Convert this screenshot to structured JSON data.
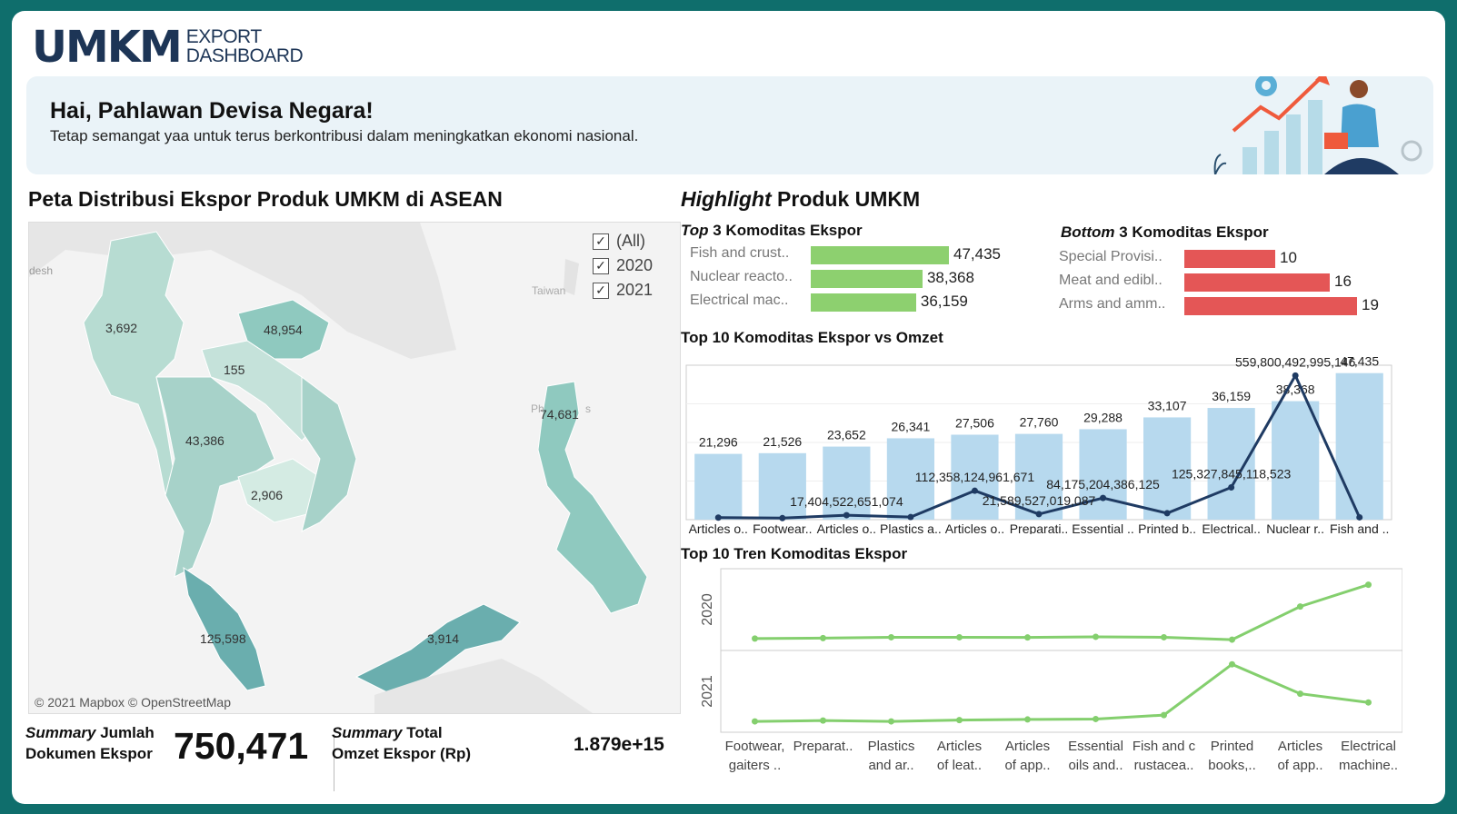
{
  "header": {
    "logo_main": "UMKM",
    "logo_sub_1": "EXPORT",
    "logo_sub_2": "DASHBOARD"
  },
  "banner": {
    "title": "Hai, Pahlawan Devisa Negara!",
    "subtitle": "Tetap semangat yaa untuk terus berkontribusi dalam meningkatkan ekonomi nasional."
  },
  "map": {
    "title": "Peta Distribusi Ekspor Produk UMKM di ASEAN",
    "values": [
      "3,692",
      "48,954",
      "155",
      "43,386",
      "2,906",
      "74,681",
      "125,598",
      "3,914"
    ],
    "place_labels": [
      "desh",
      "Taiwan",
      "Ph",
      "s"
    ],
    "copyright": "© 2021 Mapbox © OpenStreetMap",
    "filter": [
      {
        "label": "(All)",
        "checked": true
      },
      {
        "label": "2020",
        "checked": true
      },
      {
        "label": "2021",
        "checked": true
      }
    ]
  },
  "summary": {
    "docs_label_1_em": "Summary",
    "docs_label_1_rest": " Jumlah",
    "docs_label_2": "Dokumen Ekspor",
    "docs_value": "750,471",
    "omzet_label_1_em": "Summary",
    "omzet_label_1_rest": " Total",
    "omzet_label_2": "Omzet Ekspor (Rp)",
    "omzet_value": "1.879e+15"
  },
  "highlight": {
    "title_em": "Highlight",
    "title_rest": " Produk UMKM",
    "top3_title_em": "Top",
    "top3_title_rest": " 3 Komoditas Ekspor",
    "bottom3_title_em": "Bottom",
    "bottom3_title_rest": " 3 Komoditas Ekspor",
    "top10_title": "Top 10 Komoditas Ekspor vs Omzet",
    "trend_title": "Top 10 Tren Komoditas Ekspor"
  },
  "colors": {
    "green_bar": "#8dd06f",
    "red_bar": "#e45656",
    "blue_bar": "#b7d9ee",
    "navy_line": "#1f3b63",
    "trend_line": "#84cf6e",
    "map_fill": "#a7d2c9",
    "banner_bg": "#eaf3f8"
  },
  "chart_data": [
    {
      "type": "bar",
      "orientation": "horizontal",
      "title": "Top 3 Komoditas Ekspor",
      "categories": [
        "Fish and crust..",
        "Nuclear reacto..",
        "Electrical mac.."
      ],
      "values": [
        47435,
        38368,
        36159
      ],
      "value_labels": [
        "47,435",
        "38,368",
        "36,159"
      ]
    },
    {
      "type": "bar",
      "orientation": "horizontal",
      "title": "Bottom 3 Komoditas Ekspor",
      "categories": [
        "Special Provisi..",
        "Meat and edibl..",
        "Arms and amm.."
      ],
      "values": [
        10,
        16,
        19
      ],
      "value_labels": [
        "10",
        "16",
        "19"
      ]
    },
    {
      "type": "bar",
      "title": "Top 10 Komoditas Ekspor vs Omzet",
      "categories": [
        "Articles o..",
        "Footwear..",
        "Articles o..",
        "Plastics a..",
        "Articles o..",
        "Preparati..",
        "Essential ..",
        "Printed b..",
        "Electrical..",
        "Nuclear r..",
        "Fish and .."
      ],
      "series": [
        {
          "values": [
            21296,
            21526,
            23652,
            26341,
            27506,
            27760,
            29288,
            33107,
            36159,
            38368,
            47435
          ],
          "value_labels": [
            "21,296",
            "21,526",
            "23,652",
            "26,341",
            "27,506",
            "27,760",
            "29,288",
            "33,107",
            "36,159",
            "38,368",
            "47,435"
          ]
        },
        {
          "type": "line",
          "values": [
            8000000000000,
            6000000000000,
            17404522651074,
            10000000000000,
            112358124961671,
            21589527019087,
            84175204386125,
            25000000000000,
            125327845118523,
            559800492995146,
            9000000000000
          ],
          "value_labels": [
            "17,404,522,651,074",
            "112,358,124,961,671",
            "21,589,527,019,087",
            "84,175,204,386,125",
            "125,327,845,118,523",
            "559,800,492,995,146"
          ],
          "value_label_indices": [
            2,
            4,
            5,
            6,
            8,
            9
          ]
        }
      ]
    },
    {
      "type": "line",
      "title": "Top 10 Tren Komoditas Ekspor",
      "categories": [
        "Footwear, gaiters ..",
        "Preparat..",
        "Plastics and ar..",
        "Articles of leat..",
        "Articles of app..",
        "Essential oils and..",
        "Fish and c rustacea..",
        "Printed books,..",
        "Articles of app..",
        "Electrical machine.."
      ],
      "category_lines": [
        [
          "Footwear,",
          "gaiters .."
        ],
        [
          "Preparat..",
          ""
        ],
        [
          "Plastics",
          "and ar.."
        ],
        [
          "Articles",
          "of leat.."
        ],
        [
          "Articles",
          "of app.."
        ],
        [
          "Essential",
          "oils and.."
        ],
        [
          "Fish and c",
          "rustacea.."
        ],
        [
          "Printed",
          "books,.."
        ],
        [
          "Articles",
          "of app.."
        ],
        [
          "Electrical",
          "machine.."
        ]
      ],
      "rows": [
        "2020",
        "2021"
      ],
      "series": [
        {
          "name": "2020",
          "values": [
            1300,
            1500,
            1900,
            1900,
            1800,
            2100,
            1900,
            800,
            16000,
            26000
          ]
        },
        {
          "name": "2021",
          "values": [
            800,
            1200,
            800,
            1400,
            1700,
            1900,
            3700,
            27000,
            13500,
            9500
          ]
        }
      ]
    }
  ]
}
